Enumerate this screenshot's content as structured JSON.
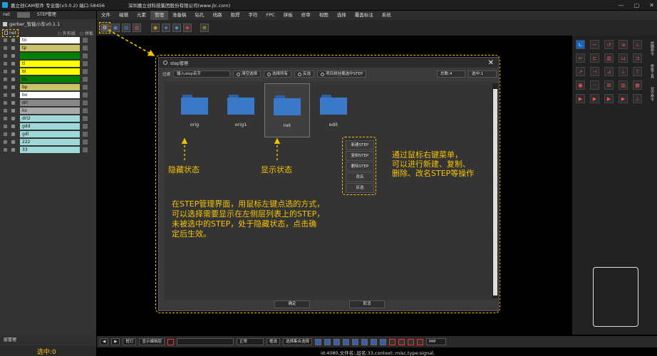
{
  "window": {
    "app_title": "嘉立创CAM软件 专业版(v3.0.2) 端口:58456",
    "company": "深圳嘉立创科技集团股份有限公司(www.jlc.com)",
    "controls": [
      "—",
      "▢",
      "✕"
    ]
  },
  "menu": [
    "文件",
    "编辑",
    "元素",
    "管理",
    "准备稿",
    "钻孔",
    "线路",
    "阻焊",
    "字符",
    "FPC",
    "拼板",
    "修审",
    "视图",
    "选择",
    "覆盖标注",
    "系统"
  ],
  "menu_active_index": 3,
  "left": {
    "tabs": [
      "net",
      "STEP管理"
    ],
    "job": "gerber_智能小车v0.1.1",
    "step": "net",
    "opts": [
      "外形线",
      "拼板"
    ],
    "layers": [
      {
        "name": "to",
        "color": "#ffffff"
      },
      {
        "name": "tp",
        "color": "#c8c26a"
      },
      {
        "name": "",
        "color": "#008000"
      },
      {
        "name": "tl",
        "color": "#ffff00"
      },
      {
        "name": "bl",
        "color": "#ffff00"
      },
      {
        "name": "bs",
        "color": "#008000"
      },
      {
        "name": "bp",
        "color": "#c8c26a"
      },
      {
        "name": "bo",
        "color": "#ffffff"
      },
      {
        "name": "drl",
        "color": "#888888"
      },
      {
        "name": "ko",
        "color": "#aaaaaa"
      },
      {
        "name": "drl2",
        "color": "#9ed8d8"
      },
      {
        "name": "gdd",
        "color": "#9ed8d8"
      },
      {
        "name": "gdl",
        "color": "#9ed8d8"
      },
      {
        "name": "222",
        "color": "#9ed8d8"
      },
      {
        "name": "33",
        "color": "#9ed8d8"
      }
    ],
    "footer_label": "层管理",
    "selected_count": "选中:0"
  },
  "dialog": {
    "title": "step管理",
    "filter_label": "过滤",
    "filter_placeholder": "输入step名字",
    "buttons": [
      "清空选择",
      "选择所有",
      "反选",
      "项目树挂载选中STEP"
    ],
    "total": "总数:4",
    "selected": "选中:1",
    "steps": [
      {
        "name": "orig"
      },
      {
        "name": "orig1"
      },
      {
        "name": "net",
        "selected": true
      },
      {
        "name": "edit"
      }
    ],
    "context_menu": [
      "新建STEP",
      "复制STEP",
      "删除STEP",
      "改名",
      "反选"
    ],
    "ok": "确定",
    "cancel": "取消"
  },
  "annotations": {
    "hidden": "隐藏状态",
    "shown": "显示状态",
    "rclick_line1": "通过鼠标右键菜单，",
    "rclick_line2": "可以进行新建、复制、",
    "rclick_line3": "删除、改名STEP等操作",
    "desc_line1": "在STEP管理界面，用鼠标左键点选的方式，",
    "desc_line2": "可以选择需要显示在左侧层列表上的STEP，",
    "desc_line3": "未被选中的STEP，处于隐藏状态，点击确",
    "desc_line4": "定后生效。"
  },
  "right": {
    "tabs": [
      "绘图命令",
      "拼板工具",
      "对齐命令"
    ]
  },
  "statusbar": {
    "mode": "框打",
    "show_btn": "显示编辑层",
    "select_mode": "正常",
    "btn1": "框选",
    "btn2": "选择集合选择",
    "units": "MM",
    "text": "id:4080,文件名:,层名:33,context::misc,type:signal,"
  },
  "colors": {
    "accent": "#f5c400",
    "folder": "#3a78c8",
    "selection": "#1565c0"
  }
}
